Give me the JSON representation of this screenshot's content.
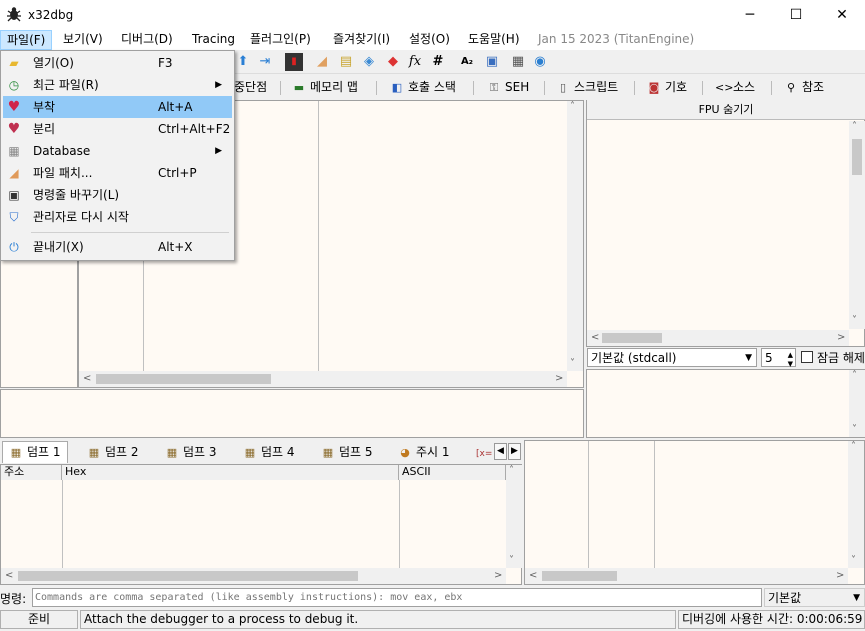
{
  "window": {
    "title": "x32dbg",
    "minimize": "─",
    "maximize": "☐",
    "close": "✕"
  },
  "menubar": {
    "items": [
      "파일(F)",
      "보기(V)",
      "디버그(D)",
      "Tracing",
      "플러그인(P)",
      "즐겨찾기(I)",
      "설정(O)",
      "도움말(H)"
    ],
    "build": "Jan 15 2023 (TitanEngine)"
  },
  "file_menu": {
    "items": [
      {
        "label": "열기(O)",
        "shortcut": "F3",
        "icon": "folder-icon"
      },
      {
        "label": "최근 파일(R)",
        "shortcut": "",
        "icon": "recent-icon",
        "submenu": true
      },
      {
        "label": "부착",
        "shortcut": "Alt+A",
        "icon": "attach-heart-icon"
      },
      {
        "label": "분리",
        "shortcut": "Ctrl+Alt+F2",
        "icon": "detach-heart-icon"
      },
      {
        "label": "Database",
        "shortcut": "",
        "icon": "database-icon",
        "submenu": true
      },
      {
        "label": "파일 패치...",
        "shortcut": "Ctrl+P",
        "icon": "patch-icon"
      },
      {
        "label": "명령줄 바꾸기(L)",
        "shortcut": "",
        "icon": "cmdline-icon"
      },
      {
        "label": "관리자로 다시 시작",
        "shortcut": "",
        "icon": "shield-icon"
      },
      {
        "label": "끝내기(X)",
        "shortcut": "Alt+X",
        "icon": "power-icon"
      }
    ]
  },
  "main_tabs": [
    "중단점",
    "메모리 맵",
    "호출 스택",
    "SEH",
    "스크립트",
    "기호",
    "소스",
    "참조"
  ],
  "fpu": {
    "header": "FPU 숨기기"
  },
  "callconv": {
    "value": "기본값 (stdcall)",
    "arg_count": "5",
    "unlock_label": "잠금 해제"
  },
  "dump_tabs": [
    "덤프 1",
    "덤프 2",
    "덤프 3",
    "덤프 4",
    "덤프 5",
    "주시 1",
    "[x="
  ],
  "dump_columns": [
    "주소",
    "Hex",
    "ASCII"
  ],
  "command": {
    "label": "명령:",
    "placeholder": "Commands are comma separated (like assembly instructions): mov eax, ebx",
    "mode": "기본값"
  },
  "status": {
    "state": "준비",
    "message": "Attach the debugger to a process to debug it.",
    "time": "디버깅에 사용한 시간: 0:00:06:59"
  },
  "colors": {
    "pane_bg": "#fffaf4",
    "menu_highlight": "#91c9f7",
    "active_menu": "#cce8ff"
  }
}
